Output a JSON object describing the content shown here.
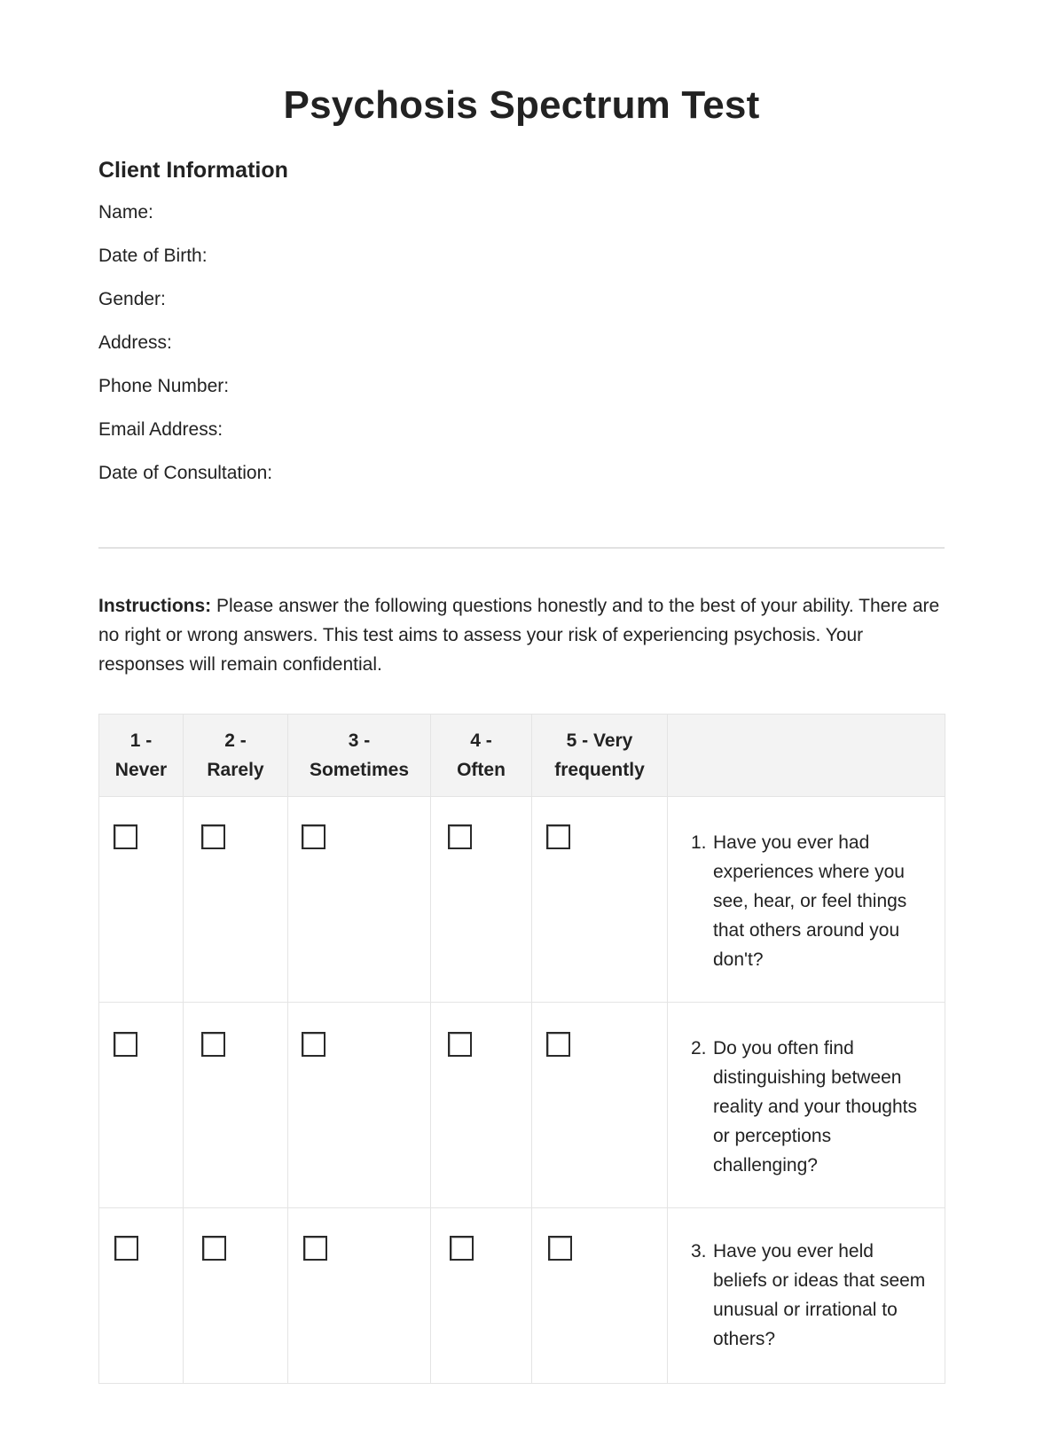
{
  "title": "Psychosis Spectrum Test",
  "client_information": {
    "heading": "Client Information",
    "fields": [
      {
        "label": "Name:",
        "value": ""
      },
      {
        "label": "Date of Birth:",
        "value": ""
      },
      {
        "label": "Gender:",
        "value": ""
      },
      {
        "label": "Address:",
        "value": ""
      },
      {
        "label": "Phone Number:",
        "value": ""
      },
      {
        "label": "Email Address:",
        "value": ""
      },
      {
        "label": "Date of Consultation:",
        "value": ""
      }
    ]
  },
  "instructions": {
    "label": "Instructions:",
    "text": " Please answer the following questions honestly and to the best of your ability. There are no right or wrong answers. This test aims to assess your risk of experiencing psychosis. Your responses will remain confidential."
  },
  "scale_table": {
    "headers": [
      {
        "line1": "1 -",
        "line2": "Never"
      },
      {
        "line1": "2 -",
        "line2": "Rarely"
      },
      {
        "line1": "3 -",
        "line2": "Sometimes"
      },
      {
        "line1": "4 -",
        "line2": "Often"
      },
      {
        "line1": "5 - Very",
        "line2": "frequently"
      },
      {
        "line1": "",
        "line2": ""
      }
    ],
    "questions": [
      {
        "number": "1.",
        "text": "Have you ever had experiences where you see, hear, or feel things that others around you don't?",
        "checked": [
          false,
          false,
          false,
          false,
          false
        ]
      },
      {
        "number": "2.",
        "text": "Do you often find distinguishing between reality and your thoughts or perceptions challenging?",
        "checked": [
          false,
          false,
          false,
          false,
          false
        ]
      },
      {
        "number": "3.",
        "text": "Have you ever held beliefs or ideas that seem unusual or irrational to others?",
        "checked": [
          false,
          false,
          false,
          false,
          false
        ]
      }
    ]
  }
}
